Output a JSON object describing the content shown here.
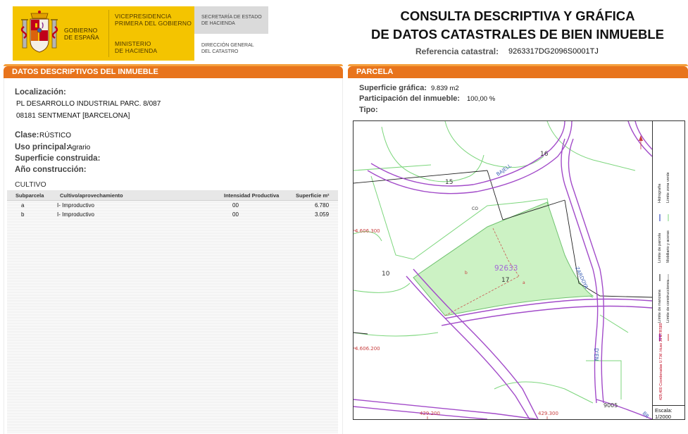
{
  "header": {
    "gobierno": [
      "GOBIERNO",
      "DE ESPAÑA"
    ],
    "vicepresidencia": [
      "VICEPRESIDENCIA",
      "PRIMERA DEL GOBIERNO"
    ],
    "ministerio": [
      "MINISTERIO",
      "DE HACIENDA"
    ],
    "secretaria": [
      "SECRETARÍA DE ESTADO",
      "DE HACIENDA"
    ],
    "direccion": [
      "DIRECCIÓN GENERAL",
      "DEL CATASTRO"
    ],
    "title_line1": "CONSULTA DESCRIPTIVA Y GRÁFICA",
    "title_line2": "DE DATOS CATASTRALES DE BIEN INMUEBLE",
    "ref_label": "Referencia catastral:",
    "ref_value": "9263317DG2096S0001TJ"
  },
  "left_section": {
    "title": "DATOS DESCRIPTIVOS DEL INMUEBLE",
    "localizacion_label": "Localización:",
    "address_line1": "PL DESARROLLO INDUSTRIAL  PARC. 8/087",
    "address_line2": "08181 SENTMENAT [BARCELONA]",
    "clase_label": "Clase:",
    "clase_value": "RÚSTICO",
    "uso_label": "Uso principal:",
    "uso_value": "Agrario",
    "superficie_construida_label": "Superficie construida:",
    "anio_label": "Año construcción:",
    "cultivo_label": "CULTIVO",
    "table": {
      "headers": [
        "Subparcela",
        "Cultivo/aprovechamiento",
        "Intensidad Productiva",
        "Superficie m²"
      ],
      "rows": [
        {
          "subparcela": "a",
          "cultivo": "I- Improductivo",
          "intensidad": "00",
          "superficie": "6.780"
        },
        {
          "subparcela": "b",
          "cultivo": "I- Improductivo",
          "intensidad": "00",
          "superficie": "3.059"
        }
      ]
    }
  },
  "right_section": {
    "title": "PARCELA",
    "superficie_grafica_label": "Superficie gráfica:",
    "superficie_grafica_value": "9.839 m2",
    "participacion_label": "Participación del inmueble:",
    "participacion_value": "100,00 %",
    "tipo_label": "Tipo:",
    "map": {
      "labels": [
        "15",
        "16",
        "17",
        "10",
        "92633",
        "9005",
        "CO",
        "a",
        "b",
        "BAJELL",
        "ZARDOYA",
        "D'EN",
        "BR"
      ],
      "coords": [
        "4.606.300",
        "4.606.200",
        "429.200",
        "429.300"
      ],
      "legend": [
        "Límite de manzana",
        "Límite de parcela",
        "Límite de construcciones",
        "Mobiliario y aceras",
        "Límite zona verde",
        "Hidrografía"
      ],
      "crs_note": "429,400 Coordenadas U.T.M. Huso 31 ETRS89",
      "scale_label": "Escala:",
      "scale_value": "1/2000"
    }
  },
  "colors": {
    "orange_bar": "#e8741c",
    "gobierno_yellow": "#f4c400",
    "parcel_fill": "#ccf2c4",
    "street_purple": "#a24bc9"
  }
}
